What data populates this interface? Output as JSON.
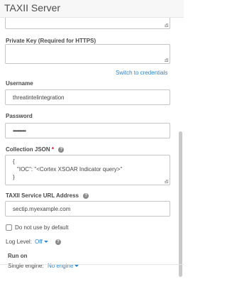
{
  "header": {
    "title": "TAXII Server"
  },
  "private_key": {
    "label": "Private Key (Required for HTTPS)",
    "switch_link": "Switch to credentials"
  },
  "username": {
    "label": "Username",
    "value": "threatintelintegration"
  },
  "password": {
    "label": "Password",
    "value": "••••••••••"
  },
  "collection_json": {
    "label": "Collection JSON",
    "required_mark": "*",
    "lines": [
      "{",
      "\"IOC\": \"<Cortex XSOAR Indicator query>\"",
      "}"
    ]
  },
  "taxii_url": {
    "label": "TAXII Service URL Address",
    "value": "sectip.myexample.com"
  },
  "do_not_use": {
    "label": "Do not use by default",
    "checked": false
  },
  "log_level": {
    "label": "Log Level:",
    "value": "Off"
  },
  "run_on": {
    "label": "Run on",
    "engine_label": "Single engine:",
    "engine_value": "No engine"
  },
  "icons": {
    "help": "question-circle-icon",
    "caret": "caret-down-icon",
    "resize": "resize-handle-icon"
  },
  "colors": {
    "link": "#2a84d2",
    "required": "#d0021b",
    "header_bg": "#f7f7f7"
  }
}
